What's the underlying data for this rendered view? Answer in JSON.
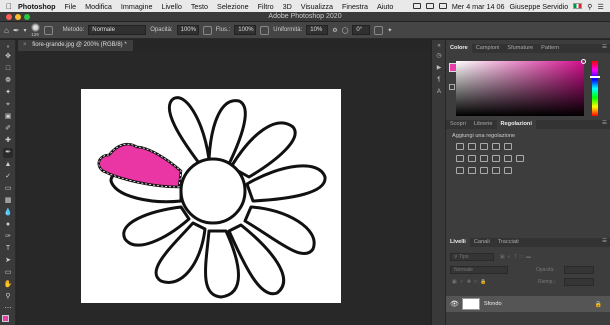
{
  "menubar": {
    "apple": "",
    "app_name": "Photoshop",
    "menus": [
      "File",
      "Modifica",
      "Immagine",
      "Livello",
      "Testo",
      "Selezione",
      "Filtro",
      "3D",
      "Visualizza",
      "Finestra",
      "Aiuto"
    ],
    "datetime": "Mer 4 mar 14 06",
    "user": "Giuseppe Servidio"
  },
  "window": {
    "title": "Adobe Photoshop 2020"
  },
  "options": {
    "brush_size": "129",
    "mode_label": "Metodo:",
    "mode_value": "Normale",
    "opacity_label": "Opacità:",
    "opacity_value": "100%",
    "flow_label": "Flus.:",
    "flow_value": "100%",
    "smoothing_label": "Uniformità:",
    "smoothing_value": "10%",
    "angle_value": "0°"
  },
  "document": {
    "tab_title": "fiore-grande.jpg @ 200% (RGB/8) *"
  },
  "colors": {
    "foreground": "#e83ea9",
    "background": "#ffffff",
    "accent_pink": "#ea35a4"
  },
  "color_panel": {
    "tabs": [
      "Colore",
      "Campioni",
      "Sfumature",
      "Pattern"
    ],
    "active_tab": "Colore"
  },
  "adjustments_panel": {
    "tabs": [
      "Scopri",
      "Librerie",
      "Regolazioni"
    ],
    "active_tab": "Regolazioni",
    "heading": "Aggiungi una regolazione"
  },
  "layers_panel": {
    "tabs": [
      "Livelli",
      "Canali",
      "Tracciati"
    ],
    "active_tab": "Livelli",
    "filter_placeholder": "Tipo",
    "blend_mode": "Normale",
    "opacity_label": "Opacità:",
    "fill_label": "Riemp.:",
    "layers": [
      {
        "name": "Sfondo",
        "visible": true,
        "locked": true
      }
    ]
  }
}
